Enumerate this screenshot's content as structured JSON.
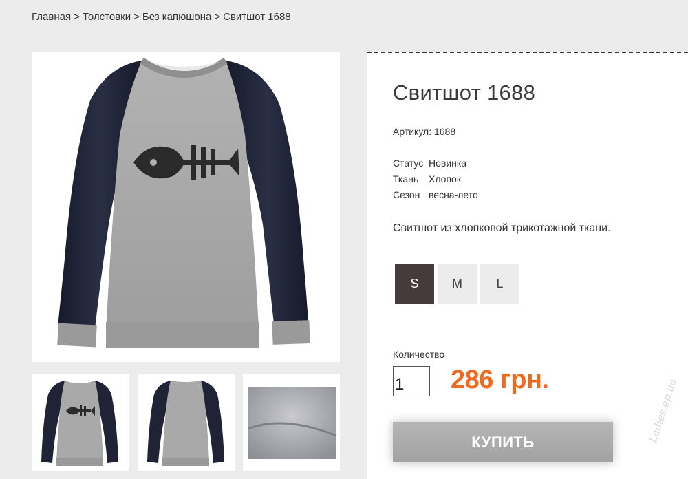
{
  "breadcrumb": {
    "items": [
      "Главная",
      "Толстовки",
      "Без капюшона",
      "Свитшот 1688"
    ],
    "separator": ">"
  },
  "product": {
    "title": "Свитшот 1688",
    "sku_label": "Артикул:",
    "sku_value": "1688",
    "properties": [
      {
        "key": "Статус",
        "value": "Новинка"
      },
      {
        "key": "Ткань",
        "value": "Хлопок"
      },
      {
        "key": "Сезон",
        "value": "весна-лето"
      }
    ],
    "description": "Свитшот из хлопковой трикотажной ткани.",
    "sizes": [
      "S",
      "M",
      "L"
    ],
    "selected_size": "S",
    "quantity_label": "Количество",
    "quantity_value": "1",
    "price": "286 грн.",
    "buy_label": "КУПИТЬ"
  },
  "images": {
    "main": "sweatshirt-front-fishbone",
    "thumbnails": [
      "sweatshirt-front-fishbone",
      "sweatshirt-back",
      "fabric-closeup"
    ]
  },
  "watermark": "Ladies.ep.ua",
  "colors": {
    "price": "#ee6a1f",
    "active_size_bg": "#453b3a",
    "buy_button": "#a8a8a8",
    "page_bg": "#ececec",
    "sleeve_navy": "#1f2335",
    "body_gray": "#a7a7a7"
  }
}
